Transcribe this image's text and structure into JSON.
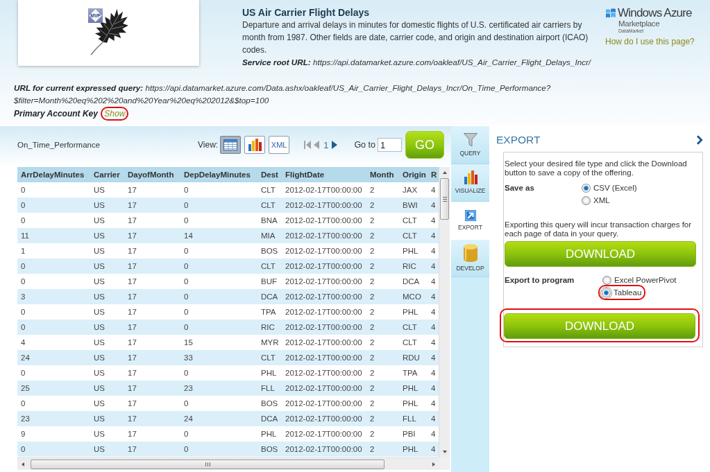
{
  "header": {
    "logo_badge": "MVP",
    "title": "US Air Carrier Flight Delays",
    "description": "Departure and arrival delays in minutes for domestic flights of U.S. certificated air carriers by month from 1987. Other fields are date, carrier code, and origin and destination airport (ICAO) codes.",
    "service_line": "**Service root URL:** https://api.datamarket.azure.com/oakleaf/US_Air_Carrier_Flight_Delays_Incr/",
    "query_line": "**URL for current expressed query:** https://api.datamarket.azure.com/Data.ashx/oakleaf/US_Air_Carrier_Flight_Delays_Incr/On_Time_Performance?$filter=Month%20eq%202%20and%20Year%20eq%202012&$top=100",
    "account_key_label": "Primary Account Key",
    "show_link": {
      "label": "Show",
      "highlighted": true
    }
  },
  "brand": {
    "name": "Windows Azure",
    "product": "Marketplace",
    "subproduct": "DataMarket",
    "help_link": "How do I use this page?"
  },
  "toolbar": {
    "dataset": "On_Time_Performance",
    "view_label": "View:",
    "views": [
      {
        "kind": "grid",
        "selected": true
      },
      {
        "kind": "chart",
        "selected": false
      },
      {
        "kind": "text",
        "label": "XML",
        "selected": false
      }
    ],
    "pager": {
      "first": {
        "disabled": true
      },
      "previous": {
        "disabled": true
      },
      "page": "1",
      "next": {
        "disabled": false
      }
    },
    "goto_label": "Go to",
    "goto_value": "1",
    "go_button": "GO"
  },
  "table": {
    "columns": [
      "ArrDelayMinutes",
      "Carrier",
      "DayofMonth",
      "DepDelayMinutes",
      "Dest",
      "FlightDate",
      "Month",
      "Origin",
      "R"
    ],
    "rows": [
      [
        "0",
        "US",
        "17",
        "0",
        "CLT",
        "2012-02-17T00:00:00",
        "2",
        "JAX",
        "4"
      ],
      [
        "0",
        "US",
        "17",
        "0",
        "CLT",
        "2012-02-17T00:00:00",
        "2",
        "BWI",
        "4"
      ],
      [
        "0",
        "US",
        "17",
        "0",
        "BNA",
        "2012-02-17T00:00:00",
        "2",
        "CLT",
        "4"
      ],
      [
        "11",
        "US",
        "17",
        "14",
        "MIA",
        "2012-02-17T00:00:00",
        "2",
        "CLT",
        "4"
      ],
      [
        "1",
        "US",
        "17",
        "0",
        "BOS",
        "2012-02-17T00:00:00",
        "2",
        "PHL",
        "4"
      ],
      [
        "0",
        "US",
        "17",
        "0",
        "CLT",
        "2012-02-17T00:00:00",
        "2",
        "RIC",
        "4"
      ],
      [
        "0",
        "US",
        "17",
        "0",
        "BUF",
        "2012-02-17T00:00:00",
        "2",
        "DCA",
        "4"
      ],
      [
        "3",
        "US",
        "17",
        "0",
        "DCA",
        "2012-02-17T00:00:00",
        "2",
        "MCO",
        "4"
      ],
      [
        "0",
        "US",
        "17",
        "0",
        "TPA",
        "2012-02-17T00:00:00",
        "2",
        "PHL",
        "4"
      ],
      [
        "0",
        "US",
        "17",
        "0",
        "RIC",
        "2012-02-17T00:00:00",
        "2",
        "CLT",
        "4"
      ],
      [
        "4",
        "US",
        "17",
        "15",
        "MYR",
        "2012-02-17T00:00:00",
        "2",
        "CLT",
        "4"
      ],
      [
        "24",
        "US",
        "17",
        "33",
        "CLT",
        "2012-02-17T00:00:00",
        "2",
        "RDU",
        "4"
      ],
      [
        "0",
        "US",
        "17",
        "0",
        "PHL",
        "2012-02-17T00:00:00",
        "2",
        "TPA",
        "4"
      ],
      [
        "25",
        "US",
        "17",
        "23",
        "FLL",
        "2012-02-17T00:00:00",
        "2",
        "PHL",
        "4"
      ],
      [
        "0",
        "US",
        "17",
        "0",
        "BOS",
        "2012-02-17T00:00:00",
        "2",
        "PHL",
        "4"
      ],
      [
        "23",
        "US",
        "17",
        "24",
        "DCA",
        "2012-02-17T00:00:00",
        "2",
        "FLL",
        "4"
      ],
      [
        "9",
        "US",
        "17",
        "0",
        "PHL",
        "2012-02-17T00:00:00",
        "2",
        "PBI",
        "4"
      ],
      [
        "0",
        "US",
        "17",
        "0",
        "BOS",
        "2012-02-17T00:00:00",
        "2",
        "PHL",
        "4"
      ]
    ]
  },
  "side_tabs": [
    {
      "label": "QUERY",
      "kind": "filter",
      "selected": false
    },
    {
      "label": "VISUALIZE",
      "kind": "chart",
      "selected": false
    },
    {
      "label": "EXPORT",
      "kind": "export",
      "selected": true
    },
    {
      "label": "DEVELOP",
      "kind": "database",
      "selected": false
    }
  ],
  "export": {
    "title": "EXPORT",
    "intro": "Select your desired file type and click the Download button to save a copy of the offering.",
    "save_as": {
      "label": "Save as",
      "options": [
        {
          "label": "CSV (Excel)",
          "selected": true
        },
        {
          "label": "XML",
          "selected": false
        }
      ]
    },
    "note": "Exporting this query will incur transaction charges for each page of data in your query.",
    "download": {
      "label": "DOWNLOAD"
    },
    "export_to_program": {
      "label": "Export to program",
      "options": [
        {
          "label": "Excel PowerPivot",
          "selected": false,
          "focused": false,
          "highlighted": false
        },
        {
          "label": "Tableau",
          "selected": true,
          "focused": true,
          "highlighted": true
        }
      ]
    },
    "program_download": {
      "label": "DOWNLOAD",
      "highlighted": true
    }
  }
}
